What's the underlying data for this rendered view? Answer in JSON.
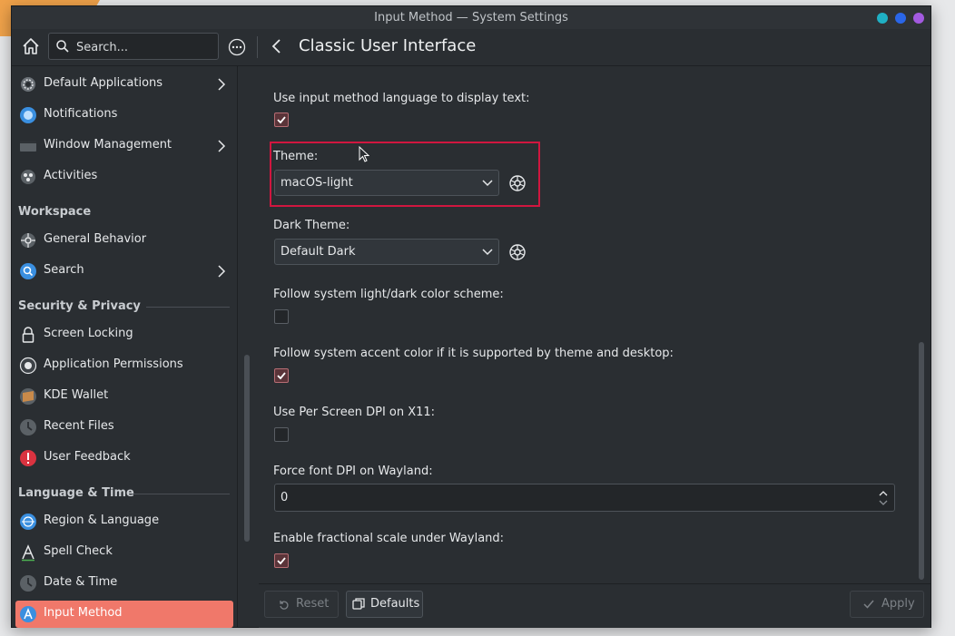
{
  "window": {
    "title": "Input Method — System Settings"
  },
  "toolbar": {
    "search_placeholder": "Search...",
    "page_title": "Classic User Interface"
  },
  "sidebar": {
    "items_top": [
      {
        "label": "Default Applications",
        "icon": "gear-icon"
      },
      {
        "label": "Notifications",
        "icon": "notifications-icon"
      },
      {
        "label": "Window Management",
        "icon": "window-icon"
      },
      {
        "label": "Activities",
        "icon": "activities-icon"
      }
    ],
    "sections": [
      {
        "header": "Workspace",
        "items": [
          {
            "label": "General Behavior",
            "icon": "behavior-icon"
          },
          {
            "label": "Search",
            "icon": "search-icon"
          }
        ]
      },
      {
        "header": "Security & Privacy",
        "items": [
          {
            "label": "Screen Locking",
            "icon": "lock-icon"
          },
          {
            "label": "Application Permissions",
            "icon": "permissions-icon"
          },
          {
            "label": "KDE Wallet",
            "icon": "wallet-icon"
          },
          {
            "label": "Recent Files",
            "icon": "clock-icon"
          },
          {
            "label": "User Feedback",
            "icon": "feedback-icon"
          }
        ]
      },
      {
        "header": "Language & Time",
        "items": [
          {
            "label": "Region & Language",
            "icon": "globe-icon"
          },
          {
            "label": "Spell Check",
            "icon": "spellcheck-icon"
          },
          {
            "label": "Date & Time",
            "icon": "clock-icon"
          },
          {
            "label": "Input Method",
            "icon": "input-method-icon"
          }
        ]
      }
    ]
  },
  "content": {
    "use_language_label": "Use input method language to display text:",
    "use_language_checked": true,
    "theme_label": "Theme:",
    "theme_value": "macOS-light",
    "dark_theme_label": "Dark Theme:",
    "dark_theme_value": "Default Dark",
    "follow_scheme_label": "Follow system light/dark color scheme:",
    "follow_scheme_checked": false,
    "follow_accent_label": "Follow system accent color if it is supported by theme and desktop:",
    "follow_accent_checked": true,
    "per_screen_dpi_label": "Use Per Screen DPI on X11:",
    "per_screen_dpi_checked": false,
    "force_dpi_label": "Force font DPI on Wayland:",
    "force_dpi_value": "0",
    "fractional_label": "Enable fractional scale under Wayland:",
    "fractional_checked": true
  },
  "footer": {
    "reset_label": "Reset",
    "defaults_label": "Defaults",
    "apply_label": "Apply"
  },
  "colors": {
    "accent": "#f0786a",
    "highlight": "#d0163f",
    "window_bg": "#2a2e32"
  }
}
